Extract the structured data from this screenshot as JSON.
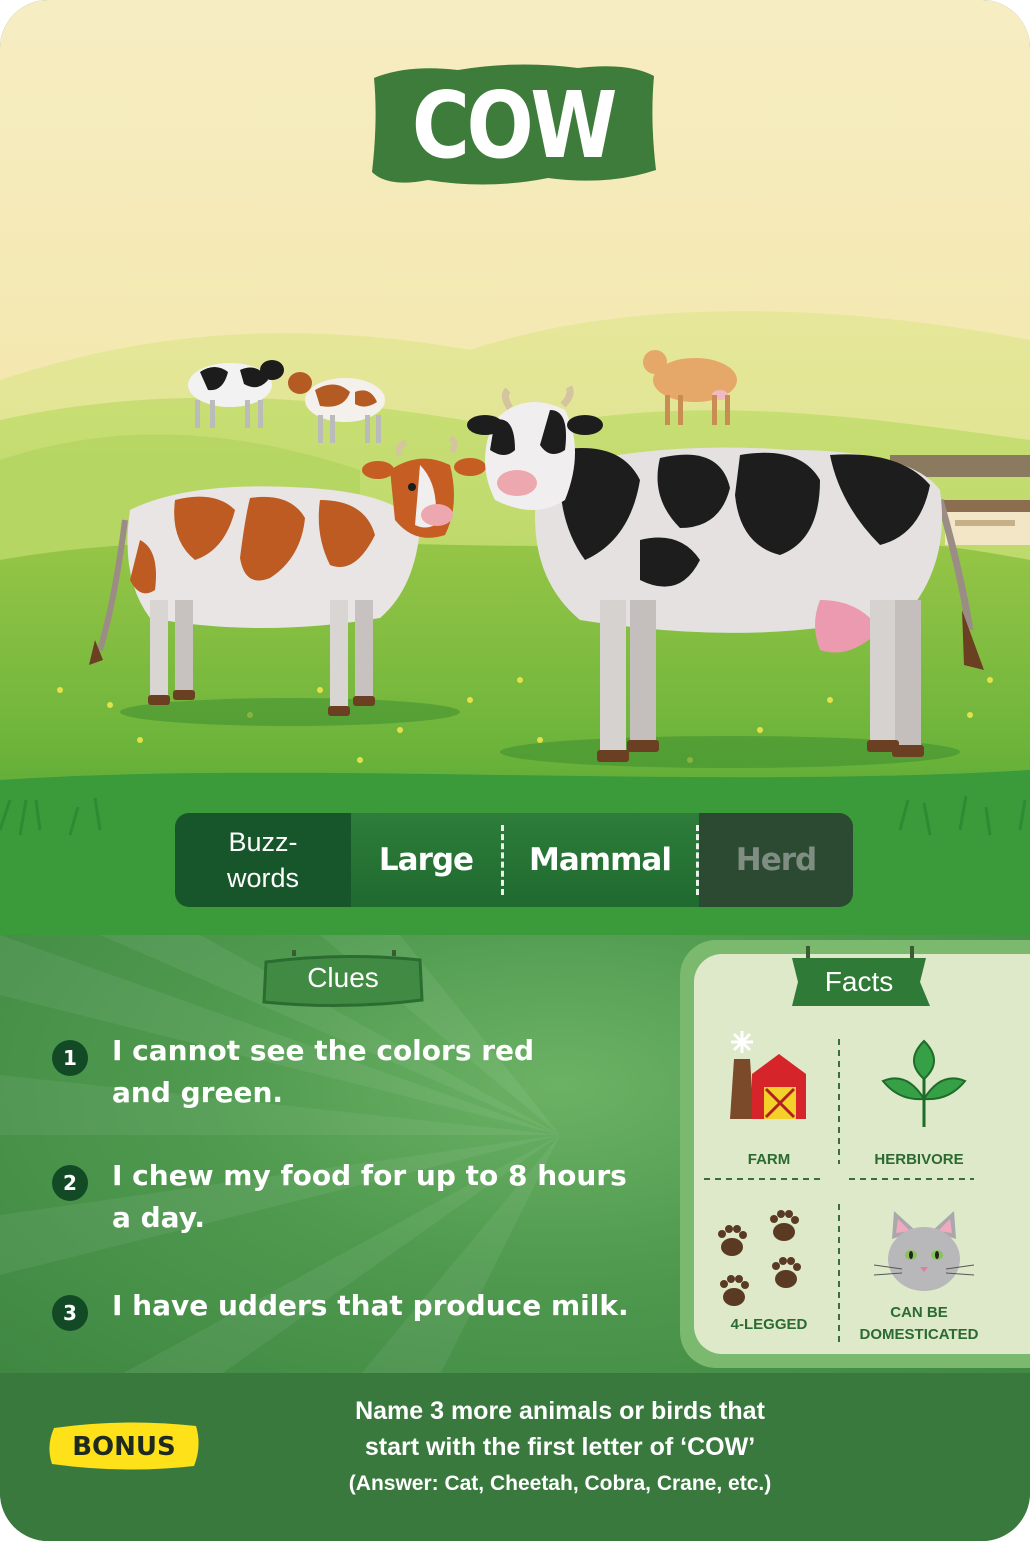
{
  "card": {
    "title": "COW"
  },
  "buzzwords": {
    "label": "Buzz-\nwords",
    "words": [
      "Large",
      "Mammal",
      "Herd"
    ]
  },
  "clues": {
    "heading": "Clues",
    "items": [
      {
        "number": "1",
        "text": "I cannot see the colors red and green."
      },
      {
        "number": "2",
        "text": "I chew my food for up to 8 hours a day."
      },
      {
        "number": "3",
        "text": "I have udders that produce milk."
      }
    ]
  },
  "facts": {
    "heading": "Facts",
    "items": [
      {
        "label": "FARM",
        "icon": "farm-icon"
      },
      {
        "label": "HERBIVORE",
        "icon": "leaf-icon"
      },
      {
        "label": "4-LEGGED",
        "icon": "paw-prints-icon"
      },
      {
        "label": "CAN BE\nDOMESTICATED",
        "icon": "cat-icon"
      }
    ]
  },
  "bonus": {
    "badge": "BONUS",
    "line1": "Name 3 more animals or birds that",
    "line2": "start with the first letter of ‘COW’",
    "answer": "(Answer: Cat, Cheetah, Cobra, Crane, etc.)"
  },
  "colors": {
    "title_plate": "#3d7c3b",
    "sky_top": "#f6edc3",
    "grass": "#5fae3a",
    "buzz_label_bg": "#17562a",
    "facts_panel": "#dde9c9",
    "bonus_badge": "#ffe11a",
    "clue_number_bg": "#134a26"
  }
}
